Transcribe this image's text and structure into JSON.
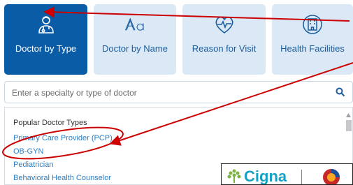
{
  "tiles": [
    {
      "label": "Doctor by Type",
      "icon": "doctor-icon",
      "active": true
    },
    {
      "label": "Doctor by Name",
      "icon": "letters-icon",
      "active": false
    },
    {
      "label": "Reason for Visit",
      "icon": "heartbeat-icon",
      "active": false
    },
    {
      "label": "Health Facilities",
      "icon": "building-icon",
      "active": false
    }
  ],
  "search": {
    "placeholder": "Enter a specialty or type of doctor",
    "icon": "search-icon"
  },
  "dropdown": {
    "heading": "Popular Doctor Types",
    "items": [
      "Primary Care Provider (PCP)",
      "OB-GYN",
      "Pediatrician",
      "Behavioral Health Counselor"
    ]
  },
  "logo": {
    "text": "Cigna"
  },
  "colors": {
    "active_tile": "#0b5ca6",
    "tile": "#dbe9f6",
    "link": "#2a7fc8",
    "annotation": "#cc0000"
  }
}
